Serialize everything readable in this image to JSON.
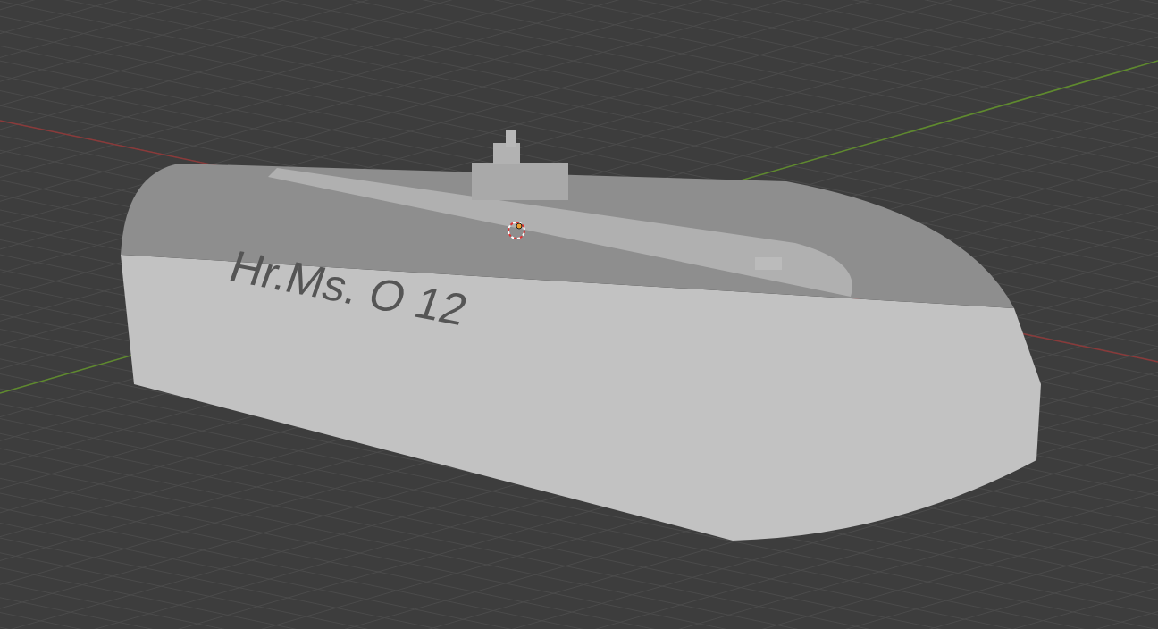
{
  "viewport": {
    "engraved_text": "Hr.Ms. O 12"
  }
}
